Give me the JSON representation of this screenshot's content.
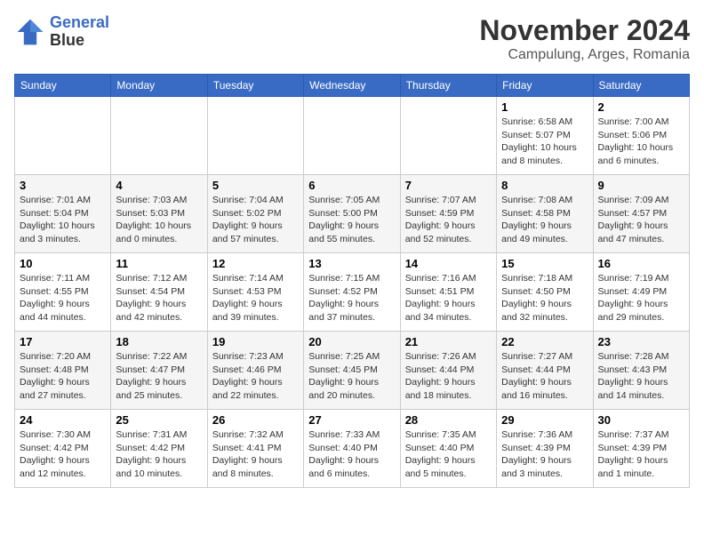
{
  "logo": {
    "line1": "General",
    "line2": "Blue"
  },
  "title": "November 2024",
  "location": "Campulung, Arges, Romania",
  "weekdays": [
    "Sunday",
    "Monday",
    "Tuesday",
    "Wednesday",
    "Thursday",
    "Friday",
    "Saturday"
  ],
  "weeks": [
    [
      {
        "day": "",
        "info": ""
      },
      {
        "day": "",
        "info": ""
      },
      {
        "day": "",
        "info": ""
      },
      {
        "day": "",
        "info": ""
      },
      {
        "day": "",
        "info": ""
      },
      {
        "day": "1",
        "info": "Sunrise: 6:58 AM\nSunset: 5:07 PM\nDaylight: 10 hours and 8 minutes."
      },
      {
        "day": "2",
        "info": "Sunrise: 7:00 AM\nSunset: 5:06 PM\nDaylight: 10 hours and 6 minutes."
      }
    ],
    [
      {
        "day": "3",
        "info": "Sunrise: 7:01 AM\nSunset: 5:04 PM\nDaylight: 10 hours and 3 minutes."
      },
      {
        "day": "4",
        "info": "Sunrise: 7:03 AM\nSunset: 5:03 PM\nDaylight: 10 hours and 0 minutes."
      },
      {
        "day": "5",
        "info": "Sunrise: 7:04 AM\nSunset: 5:02 PM\nDaylight: 9 hours and 57 minutes."
      },
      {
        "day": "6",
        "info": "Sunrise: 7:05 AM\nSunset: 5:00 PM\nDaylight: 9 hours and 55 minutes."
      },
      {
        "day": "7",
        "info": "Sunrise: 7:07 AM\nSunset: 4:59 PM\nDaylight: 9 hours and 52 minutes."
      },
      {
        "day": "8",
        "info": "Sunrise: 7:08 AM\nSunset: 4:58 PM\nDaylight: 9 hours and 49 minutes."
      },
      {
        "day": "9",
        "info": "Sunrise: 7:09 AM\nSunset: 4:57 PM\nDaylight: 9 hours and 47 minutes."
      }
    ],
    [
      {
        "day": "10",
        "info": "Sunrise: 7:11 AM\nSunset: 4:55 PM\nDaylight: 9 hours and 44 minutes."
      },
      {
        "day": "11",
        "info": "Sunrise: 7:12 AM\nSunset: 4:54 PM\nDaylight: 9 hours and 42 minutes."
      },
      {
        "day": "12",
        "info": "Sunrise: 7:14 AM\nSunset: 4:53 PM\nDaylight: 9 hours and 39 minutes."
      },
      {
        "day": "13",
        "info": "Sunrise: 7:15 AM\nSunset: 4:52 PM\nDaylight: 9 hours and 37 minutes."
      },
      {
        "day": "14",
        "info": "Sunrise: 7:16 AM\nSunset: 4:51 PM\nDaylight: 9 hours and 34 minutes."
      },
      {
        "day": "15",
        "info": "Sunrise: 7:18 AM\nSunset: 4:50 PM\nDaylight: 9 hours and 32 minutes."
      },
      {
        "day": "16",
        "info": "Sunrise: 7:19 AM\nSunset: 4:49 PM\nDaylight: 9 hours and 29 minutes."
      }
    ],
    [
      {
        "day": "17",
        "info": "Sunrise: 7:20 AM\nSunset: 4:48 PM\nDaylight: 9 hours and 27 minutes."
      },
      {
        "day": "18",
        "info": "Sunrise: 7:22 AM\nSunset: 4:47 PM\nDaylight: 9 hours and 25 minutes."
      },
      {
        "day": "19",
        "info": "Sunrise: 7:23 AM\nSunset: 4:46 PM\nDaylight: 9 hours and 22 minutes."
      },
      {
        "day": "20",
        "info": "Sunrise: 7:25 AM\nSunset: 4:45 PM\nDaylight: 9 hours and 20 minutes."
      },
      {
        "day": "21",
        "info": "Sunrise: 7:26 AM\nSunset: 4:44 PM\nDaylight: 9 hours and 18 minutes."
      },
      {
        "day": "22",
        "info": "Sunrise: 7:27 AM\nSunset: 4:44 PM\nDaylight: 9 hours and 16 minutes."
      },
      {
        "day": "23",
        "info": "Sunrise: 7:28 AM\nSunset: 4:43 PM\nDaylight: 9 hours and 14 minutes."
      }
    ],
    [
      {
        "day": "24",
        "info": "Sunrise: 7:30 AM\nSunset: 4:42 PM\nDaylight: 9 hours and 12 minutes."
      },
      {
        "day": "25",
        "info": "Sunrise: 7:31 AM\nSunset: 4:42 PM\nDaylight: 9 hours and 10 minutes."
      },
      {
        "day": "26",
        "info": "Sunrise: 7:32 AM\nSunset: 4:41 PM\nDaylight: 9 hours and 8 minutes."
      },
      {
        "day": "27",
        "info": "Sunrise: 7:33 AM\nSunset: 4:40 PM\nDaylight: 9 hours and 6 minutes."
      },
      {
        "day": "28",
        "info": "Sunrise: 7:35 AM\nSunset: 4:40 PM\nDaylight: 9 hours and 5 minutes."
      },
      {
        "day": "29",
        "info": "Sunrise: 7:36 AM\nSunset: 4:39 PM\nDaylight: 9 hours and 3 minutes."
      },
      {
        "day": "30",
        "info": "Sunrise: 7:37 AM\nSunset: 4:39 PM\nDaylight: 9 hours and 1 minute."
      }
    ]
  ]
}
